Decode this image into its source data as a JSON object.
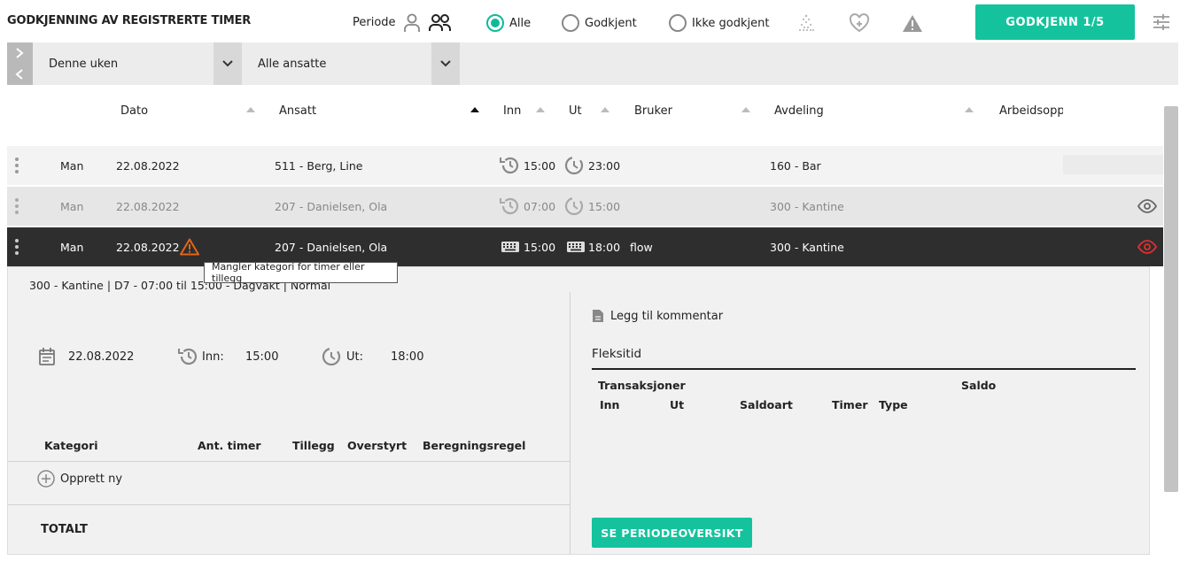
{
  "header": {
    "title": "GODKJENNING AV REGISTRERTE TIMER",
    "periode_label": "Periode",
    "filters": [
      {
        "label": "Alle",
        "selected": true
      },
      {
        "label": "Godkjent",
        "selected": false
      },
      {
        "label": "Ikke godkjent",
        "selected": false
      }
    ],
    "approve_button": "GODKJENN 1/5"
  },
  "filterbar": {
    "period_dropdown": "Denne uken",
    "employee_dropdown": "Alle ansatte"
  },
  "table": {
    "columns": [
      "Dato",
      "Ansatt",
      "Inn",
      "Ut",
      "Bruker",
      "Avdeling",
      "Arbeidsopp"
    ],
    "rows": [
      {
        "day": "Man",
        "date": "22.08.2022",
        "employee": "511 - Berg, Line",
        "in": "15:00",
        "out": "23:00",
        "user": "",
        "department": "160 - Bar",
        "state": "normal"
      },
      {
        "day": "Man",
        "date": "22.08.2022",
        "employee": "207 - Danielsen, Ola",
        "in": "07:00",
        "out": "15:00",
        "user": "",
        "department": "300 - Kantine",
        "state": "dimmed"
      },
      {
        "day": "Man",
        "date": "22.08.2022",
        "employee": "207 - Danielsen, Ola",
        "in": "15:00",
        "out": "18:00",
        "user": "flow",
        "department": "300 - Kantine",
        "state": "selected"
      }
    ]
  },
  "tooltip": "Mangler kategori for timer eller tillegg",
  "detail": {
    "shift_info": "300 - Kantine | D7 - 07:00 til 15:00 - Dagvakt | Normal",
    "date": "22.08.2022",
    "in_label": "Inn:",
    "in_value": "15:00",
    "out_label": "Ut:",
    "out_value": "18:00",
    "category_columns": [
      "Kategori",
      "Ant. timer",
      "Tillegg",
      "Overstyrt",
      "Beregningsregel"
    ],
    "create_new": "Opprett ny",
    "total_label": "TOTALT",
    "add_comment": "Legg til kommentar",
    "flex_title": "Fleksitid",
    "transactions_label": "Transaksjoner",
    "saldo_label": "Saldo",
    "tx_columns": [
      "Inn",
      "Ut",
      "Saldoart",
      "Timer",
      "Type"
    ],
    "period_button": "SE PERIODEOVERSIKT"
  },
  "colors": {
    "accent": "#14c39d",
    "selected_row": "#2e2e2e",
    "warning": "#e0661a",
    "eye_active": "#e03030"
  }
}
